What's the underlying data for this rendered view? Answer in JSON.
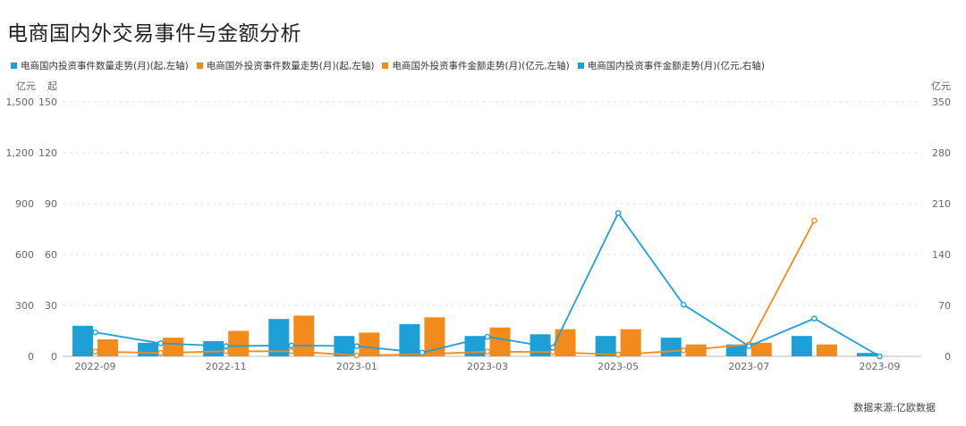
{
  "title": "电商国内外交易事件与金额分析",
  "source": "数据来源:亿欧数据",
  "colors": {
    "domestic": "#1e9fd6",
    "foreign": "#f28b1c"
  },
  "chart_data": {
    "type": "bar",
    "categories": [
      "2022-09",
      "2022-10",
      "2022-11",
      "2022-12",
      "2023-01",
      "2023-02",
      "2023-03",
      "2023-04",
      "2023-05",
      "2023-06",
      "2023-07",
      "2023-08",
      "2023-09"
    ],
    "x_tick_labels": [
      "2022-09",
      "2022-11",
      "2023-01",
      "2023-03",
      "2023-05",
      "2023-07",
      "2023-09"
    ],
    "left_axis": {
      "units": [
        "亿元",
        "起"
      ],
      "ticks_amount": [
        "0",
        "300",
        "600",
        "900",
        "1,200",
        "1,500"
      ],
      "ticks_count": [
        "0",
        "30",
        "60",
        "90",
        "120",
        "150"
      ],
      "ylim": [
        0,
        150
      ]
    },
    "right_axis": {
      "unit": "亿元",
      "ticks": [
        "0",
        "70",
        "140",
        "210",
        "280",
        "350"
      ],
      "ylim": [
        0,
        350
      ]
    },
    "series": [
      {
        "name": "电商国内投资事件数量走势(月)(起,左轴)",
        "type": "bar",
        "axis": "left",
        "color": "#1e9fd6",
        "values": [
          18,
          8,
          9,
          22,
          12,
          19,
          12,
          13,
          12,
          11,
          7,
          12,
          2
        ]
      },
      {
        "name": "电商国外投资事件数量走势(月)(起,左轴)",
        "type": "bar",
        "axis": "left",
        "color": "#f28b1c",
        "values": [
          10,
          11,
          15,
          24,
          14,
          23,
          17,
          16,
          16,
          7,
          8,
          7,
          null
        ]
      },
      {
        "name": "电商国外投资事件金额走势(月)(亿元,左轴)",
        "type": "line",
        "axis": "left",
        "color": "#f28b1c",
        "values": [
          28,
          20,
          30,
          30,
          5,
          12,
          28,
          25,
          10,
          35,
          70,
          800,
          null
        ]
      },
      {
        "name": "电商国内投资事件金额走势(月)(亿元,右轴)",
        "type": "line",
        "axis": "right",
        "color": "#1e9fd6",
        "values": [
          33,
          18,
          14,
          15,
          14,
          5,
          27,
          12,
          197,
          71,
          14,
          52,
          0
        ]
      }
    ],
    "grid": true,
    "legend_position": "top-left"
  }
}
